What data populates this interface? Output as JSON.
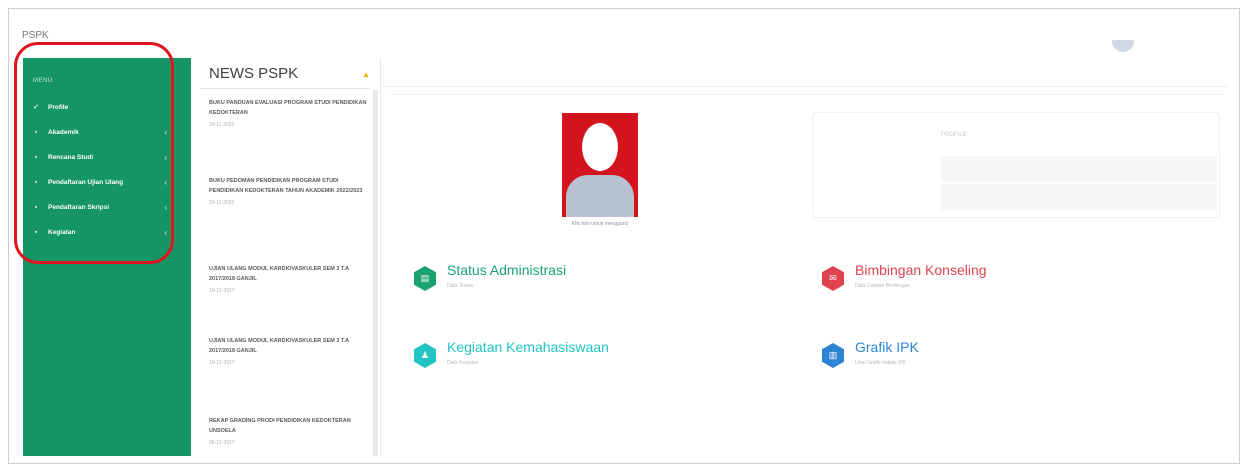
{
  "app": {
    "brand": "PSPK"
  },
  "sidebar": {
    "menu_label": "MENU",
    "items": [
      {
        "label": "Profile",
        "icon": "check-icon"
      },
      {
        "label": "Akademik",
        "icon": "grid-icon"
      },
      {
        "label": "Rencana Studi",
        "icon": "grid-icon"
      },
      {
        "label": "Pendaftaran Ujian Ulang",
        "icon": "grid-icon"
      },
      {
        "label": "Pendaftaran Skripsi",
        "icon": "grid-icon"
      },
      {
        "label": "Kegiatan",
        "icon": "grid-icon"
      }
    ]
  },
  "news": {
    "title": "NEWS PSPK",
    "items": [
      {
        "title": "BUKU PANDUAN EVALUASI PROGRAM STUDI PENDIDIKAN KEDOKTERAN",
        "date": "15-11-2022"
      },
      {
        "title": "BUKU PEDOMAN PENDIDIKAN PROGRAM STUDI PENDIDIKAN KEDOKTERAN TAHUN AKADEMIK 2022/2023",
        "date": "15-11-2022"
      },
      {
        "title": "UJIAN ULANG MODUL KARDIOVASKULER SEM 3 T.A 2017/2018 GANJIL",
        "date": "10-12-2017"
      },
      {
        "title": "UJIAN ULANG MODUL KARDIOVASKULER SEM 3 T.A 2017/2018 GANJIL",
        "date": "10-12-2017"
      },
      {
        "title": "REKAP GRADING PRODI PENDIDIKAN KEDOKTERAN UNSOELA",
        "date": "05-12-2017"
      }
    ]
  },
  "profile": {
    "photo_caption": "Klik foto untuk mengganti",
    "info_title": "PROFILE"
  },
  "tiles": [
    {
      "title": "Status Administrasi",
      "subtitle": "Data Status",
      "color": "#1aa36f",
      "icon": "document-icon"
    },
    {
      "title": "Bimbingan Konseling",
      "subtitle": "Data Catatan Bimbingan",
      "color": "#e0434f",
      "icon": "chat-icon"
    },
    {
      "title": "Kegiatan Kemahasiswaan",
      "subtitle": "Data Kegiatan",
      "color": "#22c4c4",
      "icon": "people-icon"
    },
    {
      "title": "Grafik IPK",
      "subtitle": "Lihat Grafik Indeks IPK",
      "color": "#2d84d2",
      "icon": "chart-icon"
    }
  ]
}
